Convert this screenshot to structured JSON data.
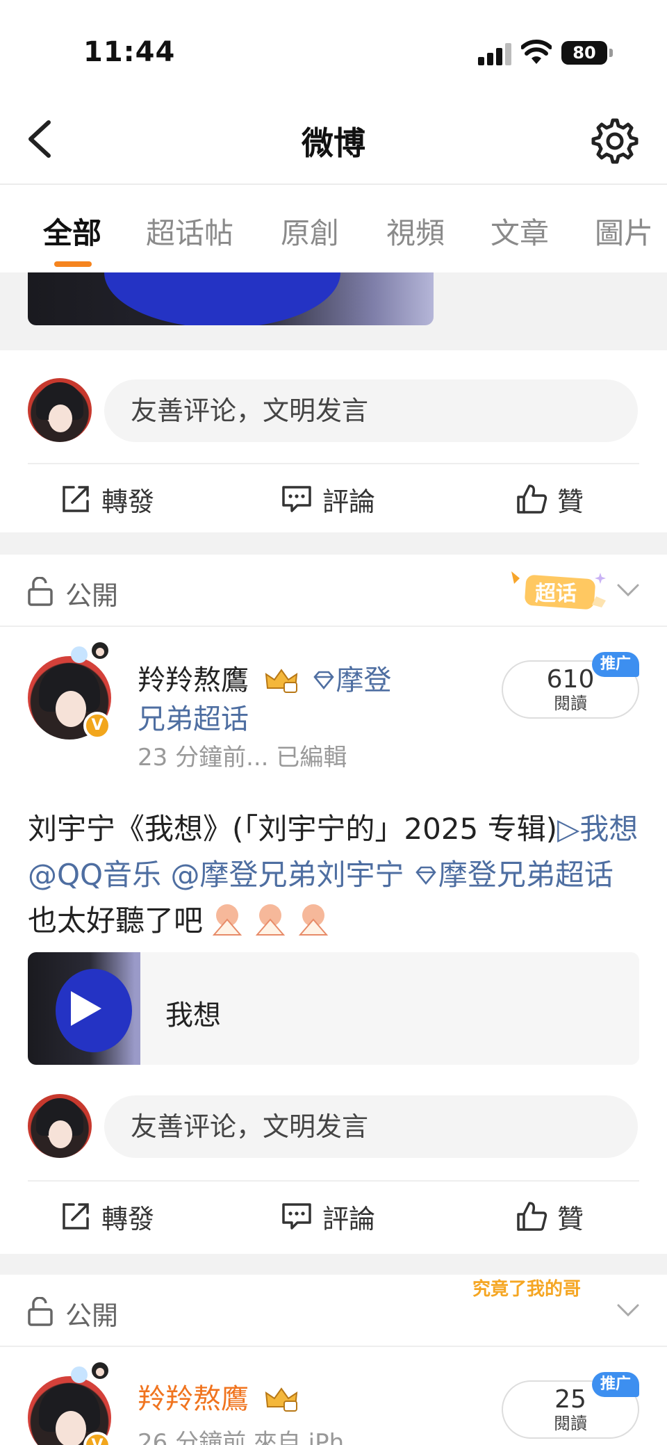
{
  "status": {
    "time": "11:44",
    "battery": "80"
  },
  "nav": {
    "title": "微博"
  },
  "tabs": [
    {
      "label": "全部"
    },
    {
      "label": "超话帖"
    },
    {
      "label": "原創"
    },
    {
      "label": "視頻"
    },
    {
      "label": "文章"
    },
    {
      "label": "圖片"
    }
  ],
  "comment_placeholder": "友善评论，文明发言",
  "actions": {
    "repost": "轉發",
    "comment": "評論",
    "like": "贊"
  },
  "posts": [
    {
      "visibility": "公開",
      "badge": "超话",
      "username": "羚羚熬鷹",
      "topic_part1": "摩登",
      "topic_part2": "兄弟超话",
      "meta": "23 分鐘前...  已編輯",
      "reads": "610",
      "reads_label": "閱讀",
      "promo": "推广",
      "text": {
        "plain1": "刘宇宁《我想》(「刘宇宁的」2025 专辑)",
        "link1": "▷我想",
        "link2": "@QQ音乐",
        "link3": "@摩登兄弟刘宇宁",
        "link4": "摩登兄弟超话",
        "plain2": "也太好聽了吧"
      },
      "music_title": "我想"
    },
    {
      "visibility": "公開",
      "sticker": "究竟了我的哥",
      "username": "羚羚熬鷹",
      "meta": "26 分鐘前  來自 iPh",
      "reads": "25",
      "reads_label": "閱讀",
      "promo": "推广"
    }
  ],
  "colors": {
    "accent": "#f5841f",
    "link": "#4e6ea1",
    "promo": "#3d8ff0",
    "username_orange": "#f0741f"
  }
}
